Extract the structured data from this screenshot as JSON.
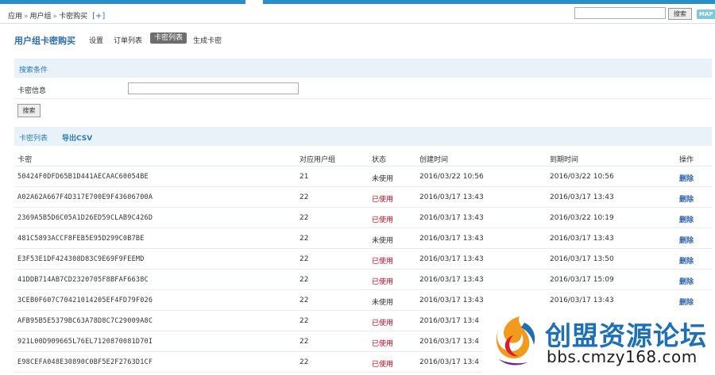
{
  "header": {
    "breadcrumb": [
      "应用",
      "用户组",
      "卡密购买"
    ],
    "breadcrumb_sep": "»",
    "add_label": "[+]",
    "search_button": "搜索",
    "map_badge": "MAP"
  },
  "nav": {
    "title": "用户组卡密购买",
    "tabs": [
      {
        "label": "设置",
        "active": false
      },
      {
        "label": "订单列表",
        "active": false
      },
      {
        "label": "卡密列表",
        "active": true
      },
      {
        "label": "生成卡密",
        "active": false
      }
    ]
  },
  "filter": {
    "section_label": "搜索条件",
    "field_label": "卡密信息",
    "field_value": "",
    "submit_label": "搜索"
  },
  "list": {
    "section_label": "卡密列表",
    "export_label": "导出CSV",
    "headers": [
      "卡密",
      "对应用户组",
      "状态",
      "创建时间",
      "到期时间",
      "操作"
    ],
    "rows": [
      {
        "code": "50424F0DFD65B1D441AECAAC60054BE",
        "user": "21",
        "status": "未使用",
        "used": false,
        "created": "2016/03/22 10:56",
        "expire": "2016/03/22 10:56",
        "action": "删除"
      },
      {
        "code": "A02A62A667F4D317E700E9F43606700A",
        "user": "22",
        "status": "已使用",
        "used": true,
        "created": "2016/03/17 13:43",
        "expire": "2016/03/17 13:43",
        "action": "删除"
      },
      {
        "code": "2369A5B5D6C05A1D26ED59CLAB9C426D",
        "user": "22",
        "status": "已使用",
        "used": true,
        "created": "2016/03/17 13:43",
        "expire": "2016/03/22 10:19",
        "action": "删除"
      },
      {
        "code": "481C5893ACCF8FEB5E95D299C0B7BE",
        "user": "22",
        "status": "未使用",
        "used": false,
        "created": "2016/03/17 13:43",
        "expire": "2016/03/17 13:43",
        "action": "删除"
      },
      {
        "code": "E3F53E1DF424308D83C9E69F9FEEMD",
        "user": "22",
        "status": "已使用",
        "used": true,
        "created": "2016/03/17 13:43",
        "expire": "2016/03/17 13:50",
        "action": "删除"
      },
      {
        "code": "41DDB714AB7CD2320705F8BFAF6638C",
        "user": "22",
        "status": "已使用",
        "used": true,
        "created": "2016/03/17 13:43",
        "expire": "2016/03/17 15:09",
        "action": "删除"
      },
      {
        "code": "3CEB0F607C70421014205EF4FD79F026",
        "user": "22",
        "status": "未使用",
        "used": false,
        "created": "2016/03/17 13:43",
        "expire": "2016/03/17 13:43",
        "action": "删除"
      },
      {
        "code": "AFB95B5E5379BC63A78D8C7C29009A8C",
        "user": "22",
        "status": "已使用",
        "used": true,
        "created": "2016/03/17 13:4",
        "expire": "",
        "action": ""
      },
      {
        "code": "921L00D909665L76EL7120870081D70I",
        "user": "22",
        "status": "已使用",
        "used": true,
        "created": "2016/03/17 13:4",
        "expire": "",
        "action": ""
      },
      {
        "code": "E98CEFA048E30890C0BF5E2F2763D1CF",
        "user": "22",
        "status": "已使用",
        "used": true,
        "created": "2016/03/17 13:4",
        "expire": "",
        "action": ""
      }
    ]
  },
  "watermark": {
    "title": "创盟资源论坛",
    "url": "bbs.cmzy168.com"
  },
  "colors": {
    "accent": "#2a8fc9",
    "link": "#2a79b8",
    "used_status": "#d0021b",
    "section_bg": "#eaf2f9"
  }
}
